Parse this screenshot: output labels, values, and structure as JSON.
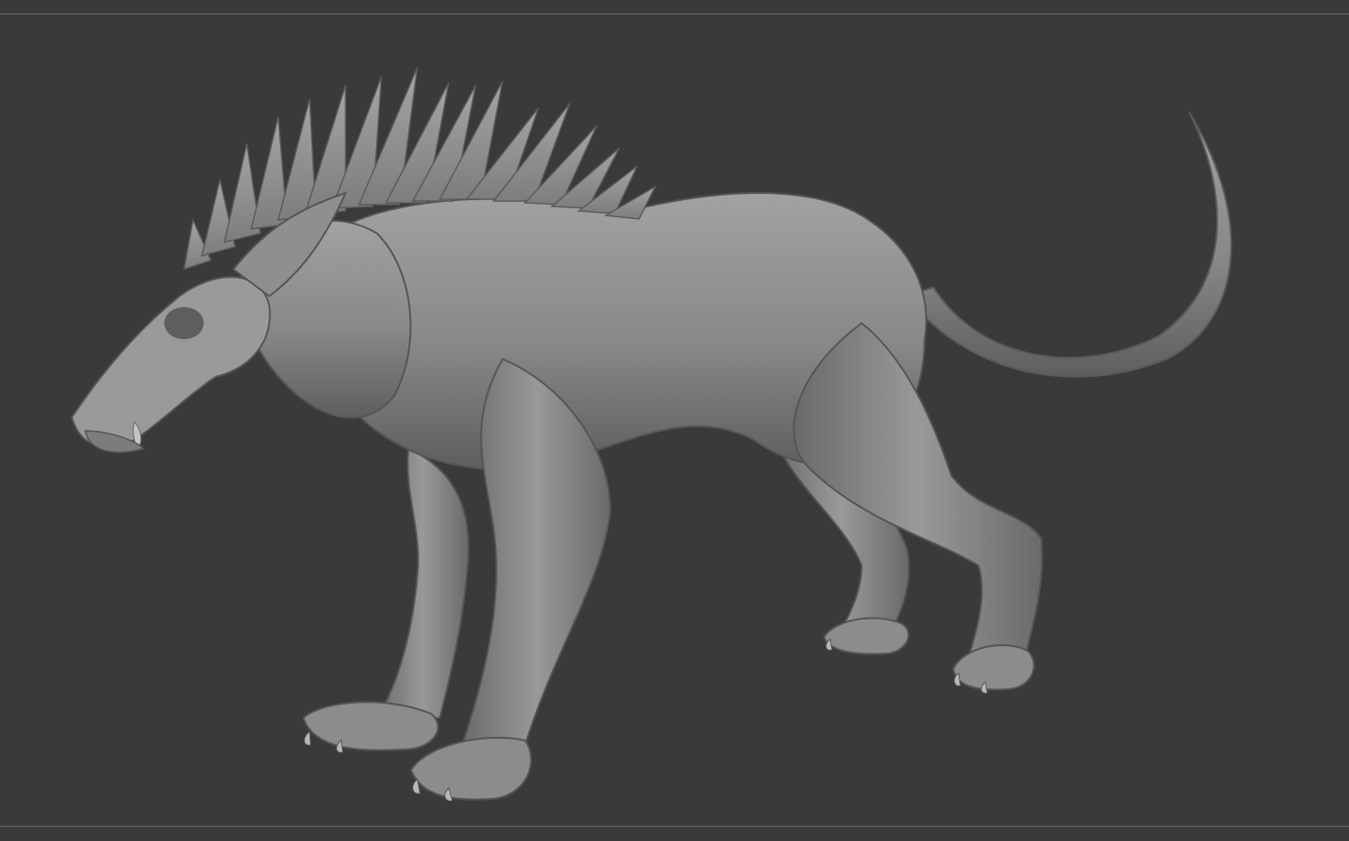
{
  "viewport": {
    "background": "#3a3a3a",
    "rule_color": "#6b6b6b",
    "model_base_color": "#8a8a8a",
    "model_highlight_color": "#a9a9a9",
    "model_shadow_color": "#5c5c5c",
    "subject": "sculpted-beast-model"
  }
}
